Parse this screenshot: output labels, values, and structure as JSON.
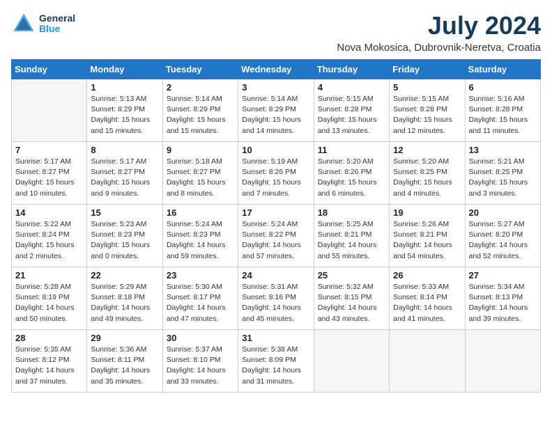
{
  "logo": {
    "line1": "General",
    "line2": "Blue"
  },
  "title": "July 2024",
  "location": "Nova Mokosica, Dubrovnik-Neretva, Croatia",
  "days_of_week": [
    "Sunday",
    "Monday",
    "Tuesday",
    "Wednesday",
    "Thursday",
    "Friday",
    "Saturday"
  ],
  "weeks": [
    [
      {
        "day": "",
        "info": ""
      },
      {
        "day": "1",
        "info": "Sunrise: 5:13 AM\nSunset: 8:29 PM\nDaylight: 15 hours\nand 15 minutes."
      },
      {
        "day": "2",
        "info": "Sunrise: 5:14 AM\nSunset: 8:29 PM\nDaylight: 15 hours\nand 15 minutes."
      },
      {
        "day": "3",
        "info": "Sunrise: 5:14 AM\nSunset: 8:29 PM\nDaylight: 15 hours\nand 14 minutes."
      },
      {
        "day": "4",
        "info": "Sunrise: 5:15 AM\nSunset: 8:28 PM\nDaylight: 15 hours\nand 13 minutes."
      },
      {
        "day": "5",
        "info": "Sunrise: 5:15 AM\nSunset: 8:28 PM\nDaylight: 15 hours\nand 12 minutes."
      },
      {
        "day": "6",
        "info": "Sunrise: 5:16 AM\nSunset: 8:28 PM\nDaylight: 15 hours\nand 11 minutes."
      }
    ],
    [
      {
        "day": "7",
        "info": "Sunrise: 5:17 AM\nSunset: 8:27 PM\nDaylight: 15 hours\nand 10 minutes."
      },
      {
        "day": "8",
        "info": "Sunrise: 5:17 AM\nSunset: 8:27 PM\nDaylight: 15 hours\nand 9 minutes."
      },
      {
        "day": "9",
        "info": "Sunrise: 5:18 AM\nSunset: 8:27 PM\nDaylight: 15 hours\nand 8 minutes."
      },
      {
        "day": "10",
        "info": "Sunrise: 5:19 AM\nSunset: 8:26 PM\nDaylight: 15 hours\nand 7 minutes."
      },
      {
        "day": "11",
        "info": "Sunrise: 5:20 AM\nSunset: 8:26 PM\nDaylight: 15 hours\nand 6 minutes."
      },
      {
        "day": "12",
        "info": "Sunrise: 5:20 AM\nSunset: 8:25 PM\nDaylight: 15 hours\nand 4 minutes."
      },
      {
        "day": "13",
        "info": "Sunrise: 5:21 AM\nSunset: 8:25 PM\nDaylight: 15 hours\nand 3 minutes."
      }
    ],
    [
      {
        "day": "14",
        "info": "Sunrise: 5:22 AM\nSunset: 8:24 PM\nDaylight: 15 hours\nand 2 minutes."
      },
      {
        "day": "15",
        "info": "Sunrise: 5:23 AM\nSunset: 8:23 PM\nDaylight: 15 hours\nand 0 minutes."
      },
      {
        "day": "16",
        "info": "Sunrise: 5:24 AM\nSunset: 8:23 PM\nDaylight: 14 hours\nand 59 minutes."
      },
      {
        "day": "17",
        "info": "Sunrise: 5:24 AM\nSunset: 8:22 PM\nDaylight: 14 hours\nand 57 minutes."
      },
      {
        "day": "18",
        "info": "Sunrise: 5:25 AM\nSunset: 8:21 PM\nDaylight: 14 hours\nand 55 minutes."
      },
      {
        "day": "19",
        "info": "Sunrise: 5:26 AM\nSunset: 8:21 PM\nDaylight: 14 hours\nand 54 minutes."
      },
      {
        "day": "20",
        "info": "Sunrise: 5:27 AM\nSunset: 8:20 PM\nDaylight: 14 hours\nand 52 minutes."
      }
    ],
    [
      {
        "day": "21",
        "info": "Sunrise: 5:28 AM\nSunset: 8:19 PM\nDaylight: 14 hours\nand 50 minutes."
      },
      {
        "day": "22",
        "info": "Sunrise: 5:29 AM\nSunset: 8:18 PM\nDaylight: 14 hours\nand 49 minutes."
      },
      {
        "day": "23",
        "info": "Sunrise: 5:30 AM\nSunset: 8:17 PM\nDaylight: 14 hours\nand 47 minutes."
      },
      {
        "day": "24",
        "info": "Sunrise: 5:31 AM\nSunset: 8:16 PM\nDaylight: 14 hours\nand 45 minutes."
      },
      {
        "day": "25",
        "info": "Sunrise: 5:32 AM\nSunset: 8:15 PM\nDaylight: 14 hours\nand 43 minutes."
      },
      {
        "day": "26",
        "info": "Sunrise: 5:33 AM\nSunset: 8:14 PM\nDaylight: 14 hours\nand 41 minutes."
      },
      {
        "day": "27",
        "info": "Sunrise: 5:34 AM\nSunset: 8:13 PM\nDaylight: 14 hours\nand 39 minutes."
      }
    ],
    [
      {
        "day": "28",
        "info": "Sunrise: 5:35 AM\nSunset: 8:12 PM\nDaylight: 14 hours\nand 37 minutes."
      },
      {
        "day": "29",
        "info": "Sunrise: 5:36 AM\nSunset: 8:11 PM\nDaylight: 14 hours\nand 35 minutes."
      },
      {
        "day": "30",
        "info": "Sunrise: 5:37 AM\nSunset: 8:10 PM\nDaylight: 14 hours\nand 33 minutes."
      },
      {
        "day": "31",
        "info": "Sunrise: 5:38 AM\nSunset: 8:09 PM\nDaylight: 14 hours\nand 31 minutes."
      },
      {
        "day": "",
        "info": ""
      },
      {
        "day": "",
        "info": ""
      },
      {
        "day": "",
        "info": ""
      }
    ]
  ]
}
